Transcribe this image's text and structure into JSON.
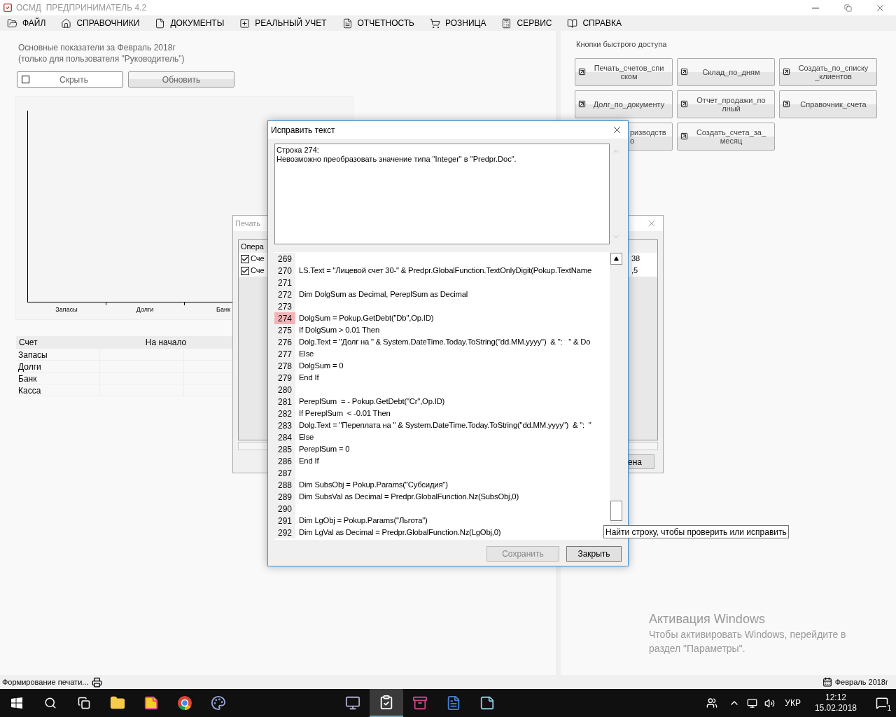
{
  "app": {
    "title": "ОСМД  ПРЕДПРИНИМАТЕЛЬ 4.2",
    "menu": [
      {
        "label": "ФАЙЛ"
      },
      {
        "label": "СПРАВОЧНИКИ"
      },
      {
        "label": "ДОКУМЕНТЫ"
      },
      {
        "label": "РЕАЛЬНЫЙ УЧЕТ"
      },
      {
        "label": "ОТЧЕТНОСТЬ"
      },
      {
        "label": "РОЗНИЦА"
      },
      {
        "label": "СЕРВИС"
      },
      {
        "label": "СПРАВКА"
      }
    ]
  },
  "dashboard": {
    "heading": "Основные показатели за Февраль 2018г",
    "subheading": "(только для пользователя \"Руководитель\")",
    "hide_toggle": {
      "label": "Скрыть",
      "checked": false
    },
    "refresh_button": "Обновить",
    "chart": {
      "categories": [
        "Запасы",
        "Долги",
        "Банк"
      ]
    },
    "table": {
      "columns": [
        "Счет",
        "На начало"
      ],
      "rows": [
        "Запасы",
        "Долги",
        "Банк",
        "Касса"
      ]
    }
  },
  "quick_access": {
    "title": "Кнопки быстрого доступа",
    "buttons": [
      {
        "kind": "shortcut",
        "lines": [
          "Печать_счетов_спи",
          "ском"
        ]
      },
      {
        "kind": "shortcut",
        "lines": [
          "Склад_по_дням"
        ]
      },
      {
        "kind": "shortcut",
        "lines": [
          "Создать_по_списку",
          "_клиентов"
        ]
      },
      {
        "kind": "shortcut",
        "lines": [
          "Долг_по_документу"
        ]
      },
      {
        "kind": "shortcut",
        "lines": [
          "Отчет_продажи_по",
          "лный"
        ]
      },
      {
        "kind": "shortcut",
        "lines": [
          "Справочник_счета"
        ]
      },
      {
        "kind": "clipped",
        "lines": [
          "ризводств",
          "о"
        ]
      },
      {
        "kind": "shortcut",
        "lines": [
          "Создать_счета_за_",
          "месяц"
        ]
      }
    ]
  },
  "print_dialog": {
    "title": "Печать",
    "list_header": "Опера",
    "rows": [
      {
        "label": "Сче",
        "checked": true,
        "value": "38"
      },
      {
        "label": "Сче",
        "checked": true,
        "value": ",5"
      }
    ],
    "button": "ена"
  },
  "edit_dialog": {
    "title": "Исправить текст",
    "message": [
      "Строка 274:",
      "Невозможно преобразовать значение типа \"Integer\" в \"Predpr.Doc\"."
    ],
    "lines": [
      {
        "number": "269",
        "highlighted": false
      },
      {
        "number": "270",
        "code": "LS.Text = \"Лицевой счет 30-\" & Predpr.GlobalFunction.TextOnlyDigit(Pokup.TextName",
        "highlighted": false
      },
      {
        "number": "271",
        "highlighted": false
      },
      {
        "number": "272",
        "code": "Dim DolgSum as Decimal, PereplSum as Decimal",
        "highlighted": false
      },
      {
        "number": "273",
        "highlighted": false
      },
      {
        "number": "274",
        "code": "DolgSum = Pokup.GetDebt(\"Db\",Op.ID)",
        "highlighted": true
      },
      {
        "number": "275",
        "code": "If DolgSum > 0.01 Then",
        "highlighted": false
      },
      {
        "number": "276",
        "code": "Dolg.Text = \"Долг на \" & System.DateTime.Today.ToString(\"dd.MM.yyyy\")  & \":   \" & Do",
        "highlighted": false
      },
      {
        "number": "277",
        "code": "Else",
        "highlighted": false
      },
      {
        "number": "278",
        "code": "DolgSum = 0",
        "highlighted": false
      },
      {
        "number": "279",
        "code": "End If",
        "highlighted": false
      },
      {
        "number": "280",
        "highlighted": false
      },
      {
        "number": "281",
        "code": "PereplSum  = - Pokup.GetDebt(\"Cr\",Op.ID)",
        "highlighted": false
      },
      {
        "number": "282",
        "code": "If PereplSum  < -0.01 Then",
        "highlighted": false
      },
      {
        "number": "283",
        "code": "Dolg.Text = \"Переплата на \" & System.DateTime.Today.ToString(\"dd.MM.yyyy\")  & \":  \"",
        "highlighted": false
      },
      {
        "number": "284",
        "code": "Else",
        "highlighted": false
      },
      {
        "number": "285",
        "code": "PereplSum = 0",
        "highlighted": false
      },
      {
        "number": "286",
        "code": "End If",
        "highlighted": false
      },
      {
        "number": "287",
        "highlighted": false
      },
      {
        "number": "288",
        "code": "Dim SubsObj = Pokup.Params(\"Субсидия\")",
        "highlighted": false
      },
      {
        "number": "289",
        "code": "Dim SubsVal as Decimal = Predpr.GlobalFunction.Nz(SubsObj,0)",
        "highlighted": false
      },
      {
        "number": "290",
        "highlighted": false
      },
      {
        "number": "291",
        "code": "Dim LgObj = Pokup.Params(\"Льгота\")",
        "highlighted": false
      },
      {
        "number": "292",
        "code": "Dim LgVal as Decimal = Predpr.GlobalFunction.Nz(LgObj,0)",
        "highlighted": false
      }
    ],
    "buttons": [
      {
        "label": "Сохранить",
        "disabled": true
      },
      {
        "label": "Закрыть",
        "disabled": false
      }
    ]
  },
  "tooltip": "Найти строку, чтобы проверить или исправить",
  "watermark": {
    "title": "Активация Windows",
    "text": "Чтобы активировать Windows, перейдите в раздел \"Параметры\"."
  },
  "status_bar": {
    "left": "Формирование печати...",
    "right": "Февраль 2018г"
  },
  "taskbar": {
    "language": "УКР",
    "time": "12:12",
    "date": "15.02.2018",
    "notifications": "1"
  }
}
